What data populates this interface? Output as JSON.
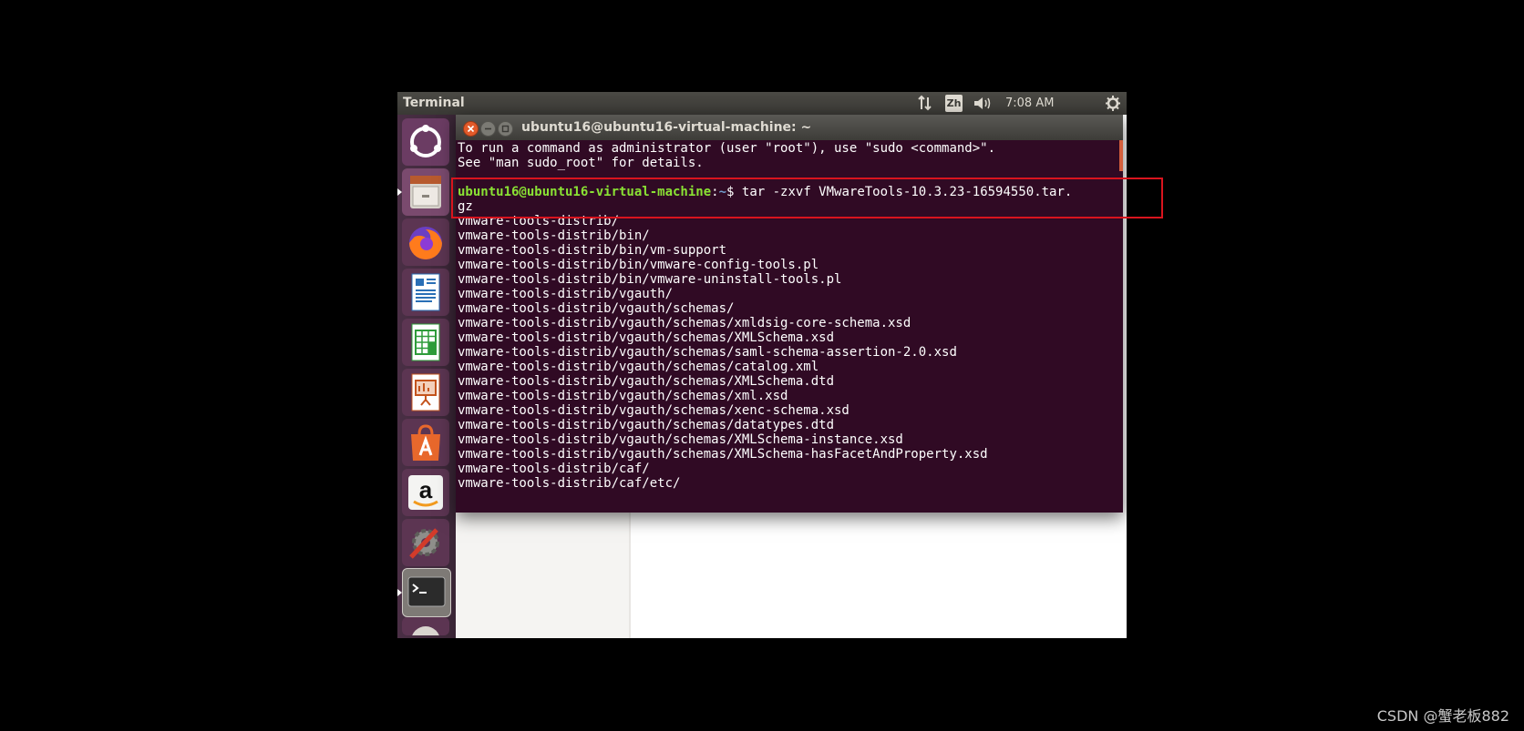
{
  "topbar": {
    "app_title": "Terminal",
    "input_method": "Zh",
    "clock": "7:08 AM",
    "icons": [
      "network-icon",
      "keyboard-icon",
      "volume-icon",
      "settings-icon"
    ]
  },
  "launcher": {
    "items": [
      "dash-icon",
      "files-icon",
      "firefox-icon",
      "writer-icon",
      "calc-icon",
      "impress-icon",
      "software-center-icon",
      "amazon-icon",
      "system-settings-icon",
      "terminal-icon",
      "dvd-icon"
    ]
  },
  "terminal": {
    "title": "ubuntu16@ubuntu16-virtual-machine: ~",
    "prompt_user": "ubuntu16@ubuntu16-virtual-machine",
    "prompt_sep": ":",
    "prompt_path": "~",
    "prompt_dollar": "$",
    "command": " tar -zxvf VMwareTools-10.3.23-16594550.tar.",
    "command_wrap": "gz",
    "header_lines": [
      "To run a command as administrator (user \"root\"), use \"sudo <command>\".",
      "See \"man sudo_root\" for details."
    ],
    "output_lines": [
      "vmware-tools-distrib/",
      "vmware-tools-distrib/bin/",
      "vmware-tools-distrib/bin/vm-support",
      "vmware-tools-distrib/bin/vmware-config-tools.pl",
      "vmware-tools-distrib/bin/vmware-uninstall-tools.pl",
      "vmware-tools-distrib/vgauth/",
      "vmware-tools-distrib/vgauth/schemas/",
      "vmware-tools-distrib/vgauth/schemas/xmldsig-core-schema.xsd",
      "vmware-tools-distrib/vgauth/schemas/XMLSchema.xsd",
      "vmware-tools-distrib/vgauth/schemas/saml-schema-assertion-2.0.xsd",
      "vmware-tools-distrib/vgauth/schemas/catalog.xml",
      "vmware-tools-distrib/vgauth/schemas/XMLSchema.dtd",
      "vmware-tools-distrib/vgauth/schemas/xml.xsd",
      "vmware-tools-distrib/vgauth/schemas/xenc-schema.xsd",
      "vmware-tools-distrib/vgauth/schemas/datatypes.dtd",
      "vmware-tools-distrib/vgauth/schemas/XMLSchema-instance.xsd",
      "vmware-tools-distrib/vgauth/schemas/XMLSchema-hasFacetAndProperty.xsd",
      "vmware-tools-distrib/caf/",
      "vmware-tools-distrib/caf/etc/"
    ]
  },
  "colors": {
    "terminal_bg": "#300a24",
    "prompt_user": "#8ae234",
    "prompt_path": "#729fcf",
    "highlight": "#d9141e"
  },
  "watermark": "CSDN @蟹老板882"
}
